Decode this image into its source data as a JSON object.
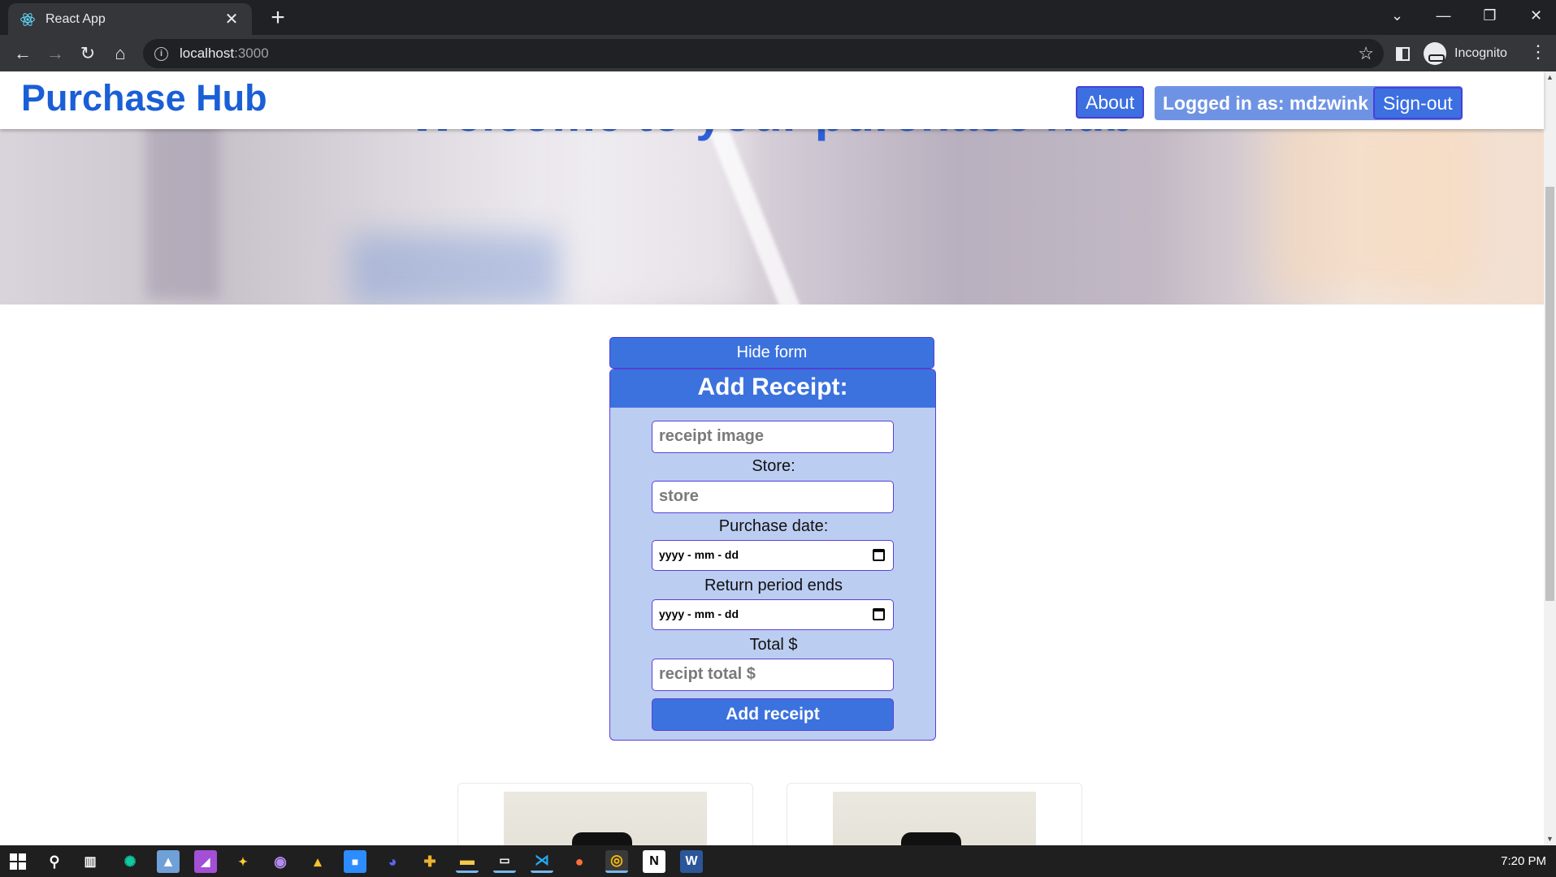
{
  "browser": {
    "tab_title": "React App",
    "url_host": "localhost",
    "url_port": ":3000",
    "profile_label": "Incognito"
  },
  "header": {
    "brand": "Purchase Hub",
    "about_label": "About",
    "logged_in_text": "Logged in as: mdzwink",
    "signout_label": "Sign-out"
  },
  "hero": {
    "title": "Welcome to your purchase hub"
  },
  "form": {
    "toggle_label": "Hide form",
    "heading": "Add Receipt:",
    "image_placeholder": "receipt image",
    "store_label": "Store:",
    "store_placeholder": "store",
    "purchase_date_label": "Purchase date:",
    "purchase_date_value": "yyyy - mm - dd",
    "return_label": "Return period ends",
    "return_date_value": "yyyy - mm - dd",
    "total_label": "Total $",
    "total_placeholder": "recipt total $",
    "submit_label": "Add receipt"
  },
  "taskbar": {
    "time": "7:20 PM",
    "icons": [
      "windows-start-icon",
      "search-icon",
      "task-view-icon",
      "chatgpt-icon",
      "photos-icon",
      "affinity-icon",
      "davinci-icon",
      "github-icon",
      "linux-icon",
      "zoom-icon",
      "discord-icon",
      "slack-icon",
      "file-explorer-icon",
      "terminal-icon",
      "vscode-icon",
      "firefox-icon",
      "chrome-icon",
      "notion-icon",
      "word-icon"
    ]
  },
  "colors": {
    "brand": "#1a5fd6",
    "button": "#3c72de",
    "form_bg": "#bccdf2",
    "border": "#5b3fd6"
  }
}
